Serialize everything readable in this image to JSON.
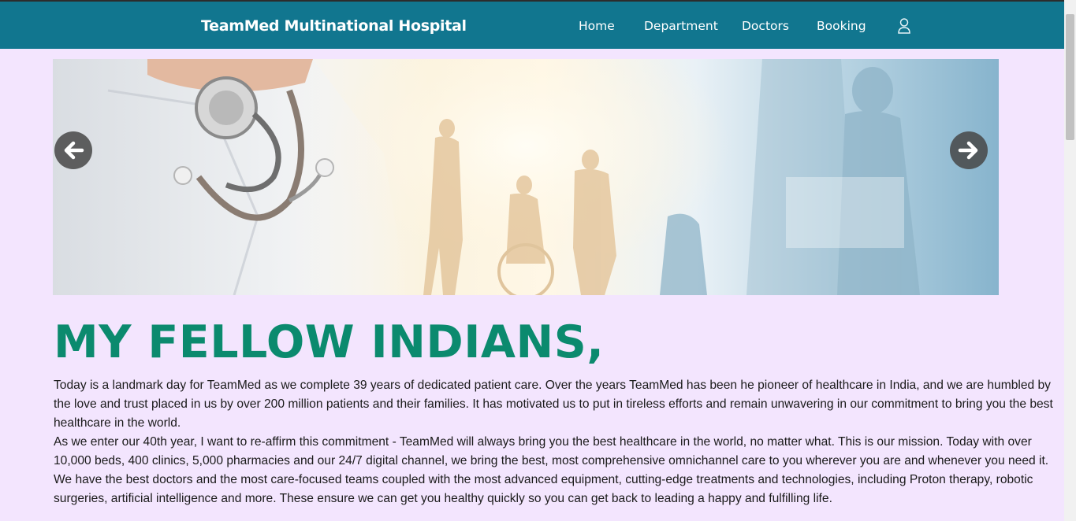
{
  "navbar": {
    "brand": "TeamMed Multinational Hospital",
    "links": [
      "Home",
      "Department",
      "Doctors",
      "Booking"
    ],
    "user_icon": "user-icon",
    "bg_color": "#11768f"
  },
  "carousel": {
    "prev_icon": "arrow-left-icon",
    "next_icon": "arrow-right-icon"
  },
  "main": {
    "headline": "MY FELLOW INDIANS,",
    "headline_color": "#0b8a6e",
    "paragraphs": [
      "Today is a landmark day for TeamMed as we complete 39 years of dedicated patient care. Over the years TeamMed has been he pioneer of healthcare in India, and we are humbled by the love and trust placed in us by over 200 million patients and their families. It has motivated us to put in tireless efforts and remain unwavering in our commitment to bring you the best healthcare in the world.",
      "As we enter our 40th year, I want to re-affirm this commitment - TeamMed will always bring you the best healthcare in the world, no matter what. This is our mission. Today with over 10,000 beds, 400 clinics, 5,000 pharmacies and our 24/7 digital channel, we bring the best, most comprehensive omnichannel care to you wherever you are and whenever you need it.",
      "We have the best doctors and the most care-focused teams coupled with the most advanced equipment, cutting-edge treatments and technologies, including Proton therapy, robotic surgeries, artificial intelligence and more. These ensure we can get you healthy quickly so you can get back to leading a happy and fulfilling life."
    ]
  },
  "page_bg": "#f3e5fe"
}
